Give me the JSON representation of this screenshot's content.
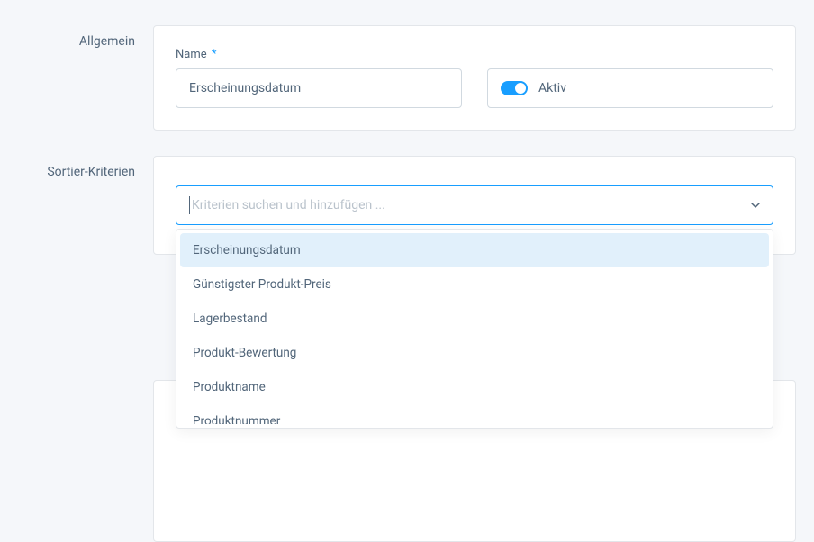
{
  "general": {
    "section_label": "Allgemein",
    "name_label": "Name",
    "name_value": "Erscheinungsdatum",
    "required_mark": "*",
    "active_label": "Aktiv",
    "active_on": true
  },
  "sorting": {
    "section_label": "Sortier-Kriterien",
    "placeholder": "Kriterien suchen und hinzufügen ...",
    "options": [
      "Erscheinungsdatum",
      "Günstigster Produkt-Preis",
      "Lagerbestand",
      "Produkt-Bewertung",
      "Produktname",
      "Produktnummer"
    ],
    "highlighted_index": 0
  },
  "colors": {
    "accent": "#189eff",
    "border": "#d1d9e0",
    "text": "#52667a",
    "page_bg": "#f5f7fa"
  }
}
